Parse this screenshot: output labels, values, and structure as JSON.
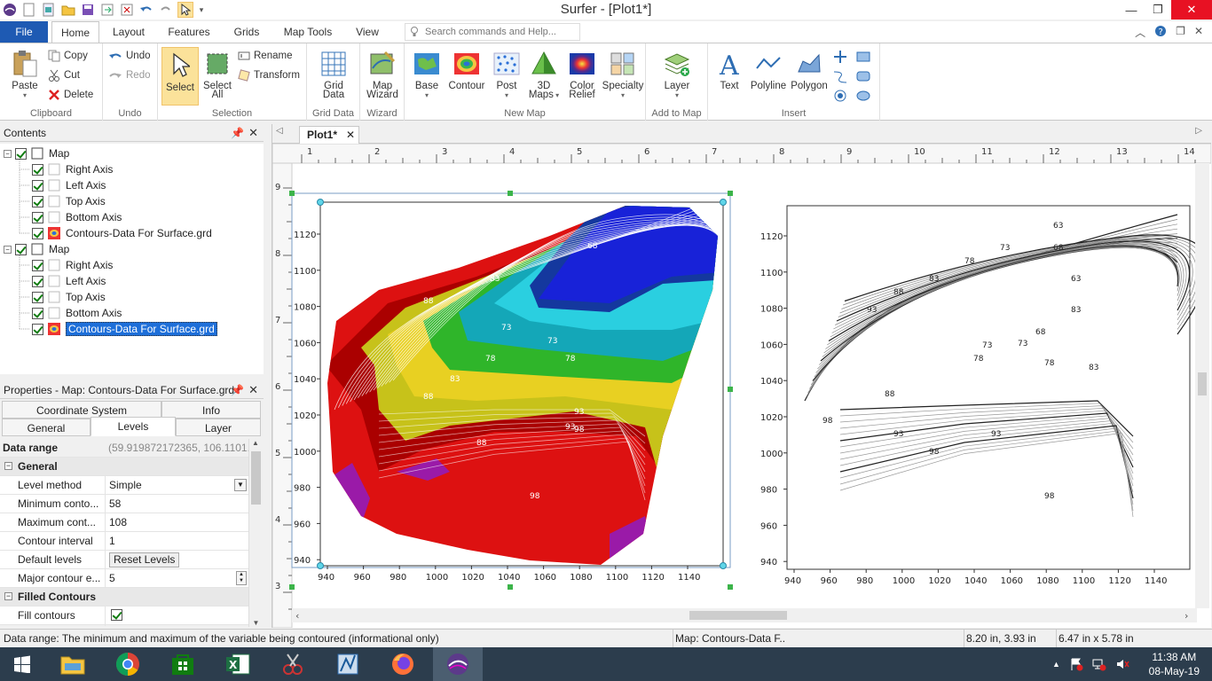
{
  "window": {
    "title": "Surfer - [Plot1*]"
  },
  "menu": {
    "file": "File",
    "tabs": [
      "Home",
      "Layout",
      "Features",
      "Grids",
      "Map Tools",
      "View"
    ],
    "search_placeholder": "Search commands and Help..."
  },
  "ribbon": {
    "clipboard": {
      "label": "Clipboard",
      "paste": "Paste",
      "copy": "Copy",
      "cut": "Cut",
      "delete": "Delete"
    },
    "undo": {
      "label": "Undo",
      "undo": "Undo",
      "redo": "Redo"
    },
    "selection": {
      "label": "Selection",
      "select": "Select",
      "select_all": "Select",
      "select_all2": "All",
      "rename": "Rename",
      "transform": "Transform"
    },
    "grid_data": {
      "label": "Grid Data",
      "btn1": "Grid",
      "btn2": "Data"
    },
    "wizard": {
      "label": "Wizard",
      "btn1": "Map",
      "btn2": "Wizard"
    },
    "new_map": {
      "label": "New Map",
      "base": "Base",
      "contour": "Contour",
      "post": "Post",
      "maps3d_1": "3D",
      "maps3d_2": "Maps",
      "relief1": "Color",
      "relief2": "Relief",
      "specialty": "Specialty"
    },
    "add_to_map": {
      "label": "Add to Map",
      "layer": "Layer"
    },
    "insert": {
      "label": "Insert",
      "text": "Text",
      "polyline": "Polyline",
      "polygon": "Polygon"
    }
  },
  "contents": {
    "title": "Contents",
    "tree": [
      {
        "label": "Map",
        "level": 0
      },
      {
        "label": "Right Axis",
        "level": 1
      },
      {
        "label": "Left Axis",
        "level": 1
      },
      {
        "label": "Top Axis",
        "level": 1
      },
      {
        "label": "Bottom Axis",
        "level": 1
      },
      {
        "label": "Contours-Data For Surface.grd",
        "level": 1
      },
      {
        "label": "Map",
        "level": 0
      },
      {
        "label": "Right Axis",
        "level": 1
      },
      {
        "label": "Left Axis",
        "level": 1
      },
      {
        "label": "Top Axis",
        "level": 1
      },
      {
        "label": "Bottom Axis",
        "level": 1
      },
      {
        "label": "Contours-Data For Surface.grd",
        "level": 1
      }
    ]
  },
  "properties": {
    "title": "Properties - Map: Contours-Data For Surface.grd",
    "tabs_row1": [
      "Coordinate System",
      "Info"
    ],
    "tabs_row2": [
      "General",
      "Levels",
      "Layer"
    ],
    "data_range_label": "Data range",
    "data_range_value": "(59.919872172365, 106.1101...",
    "section_general": "General",
    "rows": [
      {
        "k": "Level method",
        "v": "Simple"
      },
      {
        "k": "Minimum conto...",
        "v": "58"
      },
      {
        "k": "Maximum cont...",
        "v": "108"
      },
      {
        "k": "Contour interval",
        "v": "1"
      },
      {
        "k": "Default levels",
        "v": "Reset Levels"
      },
      {
        "k": "Major contour e...",
        "v": "5"
      }
    ],
    "section_filled": "Filled Contours",
    "fill_contours": "Fill contours"
  },
  "document": {
    "tab": "Plot1*",
    "ruler_top": [
      "1",
      "2",
      "3",
      "4",
      "5",
      "6",
      "7",
      "8",
      "9",
      "10",
      "11",
      "12",
      "13",
      "14"
    ],
    "ruler_left": [
      "9",
      "8",
      "7",
      "6",
      "5",
      "4",
      "3"
    ],
    "x_ticks": [
      "940",
      "960",
      "980",
      "1000",
      "1020",
      "1040",
      "1060",
      "1080",
      "1100",
      "1120",
      "1140"
    ],
    "y_ticks": [
      "1120",
      "1100",
      "1080",
      "1060",
      "1040",
      "1020",
      "1000",
      "980",
      "960",
      "940"
    ],
    "labels_left": [
      "88",
      "83",
      "78",
      "73",
      "73",
      "78",
      "68",
      "83",
      "88",
      "93",
      "98",
      "88",
      "93",
      "98"
    ],
    "labels_right": [
      "93",
      "88",
      "83",
      "78",
      "73",
      "68",
      "63",
      "63",
      "73",
      "73",
      "78",
      "78",
      "83",
      "68",
      "83",
      "88",
      "93",
      "98",
      "93",
      "98",
      "98"
    ]
  },
  "status": {
    "help": "Data range: The minimum and maximum of the variable being contoured (informational only)",
    "selection": "Map: Contours-Data F...",
    "cursor": "8.20 in, 3.93 in",
    "size": "6.47 in x 5.78 in"
  },
  "taskbar": {
    "time": "11:38 AM",
    "date": "08-May-19"
  }
}
